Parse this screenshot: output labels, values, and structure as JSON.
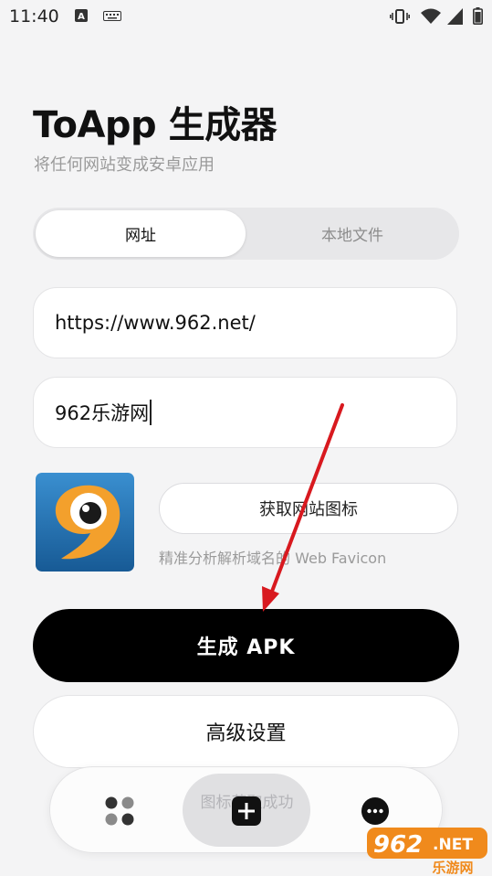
{
  "status_bar": {
    "time": "11:40",
    "accent": "#333333"
  },
  "header": {
    "title": "ToApp 生成器",
    "subtitle": "将任何网站变成安卓应用"
  },
  "segment": {
    "tabs": [
      {
        "label": "网址",
        "active": true
      },
      {
        "label": "本地文件",
        "active": false
      }
    ]
  },
  "form": {
    "url_value": "https://www.962.net/",
    "name_value": "962乐游网"
  },
  "favicon": {
    "fetch_label": "获取网站图标",
    "hint": "精准分析解析域名的 Web Favicon",
    "icon": "962-logo-icon",
    "colors": {
      "bg": "#1f6fb0",
      "accent": "#f3a02c"
    }
  },
  "actions": {
    "generate_label": "生成 APK",
    "advanced_label": "高级设置"
  },
  "toast": "图标获取成功",
  "bottom_nav": {
    "items": [
      {
        "icon": "grid-icon"
      },
      {
        "icon": "add-icon"
      },
      {
        "icon": "more-icon"
      }
    ]
  },
  "annotation": {
    "color": "#d8191f"
  },
  "watermark": {
    "brand": "962.NET",
    "tagline": "乐游网"
  }
}
